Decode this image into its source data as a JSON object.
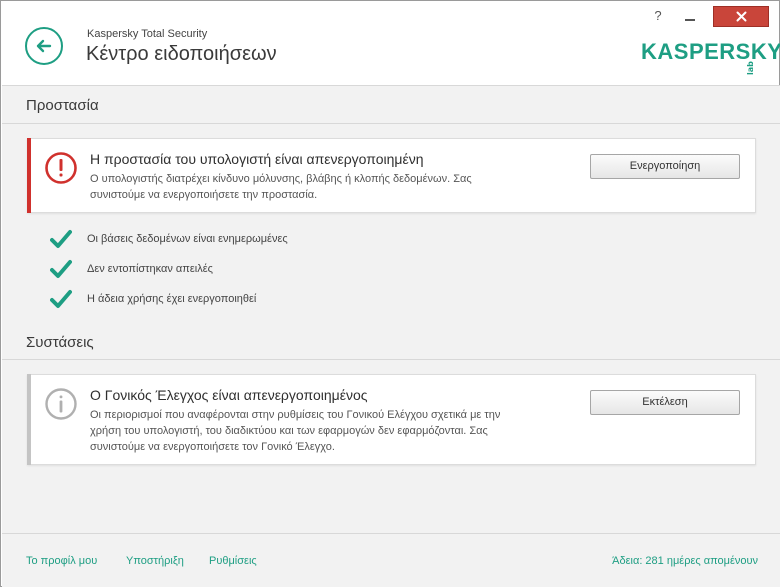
{
  "window": {
    "app_name": "Kaspersky Total Security",
    "title": "Κέντρο ειδοποιήσεων",
    "help_label": "?",
    "logo_text": "KASPERSKY",
    "logo_suffix": "lab"
  },
  "colors": {
    "accent": "#1e9e83",
    "danger": "#d0312d",
    "info": "#b0b0b0",
    "close": "#c9453a"
  },
  "protection": {
    "section_title": "Προστασία",
    "alert": {
      "icon": "exclamation-circle-icon",
      "title": "Η προστασία του υπολογιστή είναι απενεργοποιημένη",
      "description_line1": "Ο υπολογιστής διατρέχει κίνδυνο μόλυνσης, βλάβης ή κλοπής δεδομένων. Σας",
      "description_line2": "συνιστούμε να ενεργοποιήσετε την προστασία.",
      "button_label": "Ενεργοποίηση"
    },
    "status_items": [
      {
        "icon": "checkmark-icon",
        "label": "Οι βάσεις δεδομένων είναι ενημερωμένες"
      },
      {
        "icon": "checkmark-icon",
        "label": "Δεν εντοπίστηκαν απειλές"
      },
      {
        "icon": "checkmark-icon",
        "label": "Η άδεια χρήσης έχει ενεργοποιηθεί"
      }
    ]
  },
  "recommendations": {
    "section_title": "Συστάσεις",
    "card": {
      "icon": "info-circle-icon",
      "title": "Ο Γονικός Έλεγχος είναι απενεργοποιημένος",
      "description_line1": "Οι περιορισμοί που αναφέρονται στην ρυθμίσεις του Γονικού Ελέγχου σχετικά με την",
      "description_line2": "χρήση του υπολογιστή, του διαδικτύου και των εφαρμογών δεν εφαρμόζονται. Σας",
      "description_line3": "συνιστούμε να ενεργοποιήσετε τον Γονικό Έλεγχο.",
      "button_label": "Εκτέλεση"
    }
  },
  "footer": {
    "links": [
      "Το προφίλ μου",
      "Υποστήριξη",
      "Ρυθμίσεις"
    ],
    "license_status": "Άδεια: 281 ημέρες απομένουν"
  }
}
